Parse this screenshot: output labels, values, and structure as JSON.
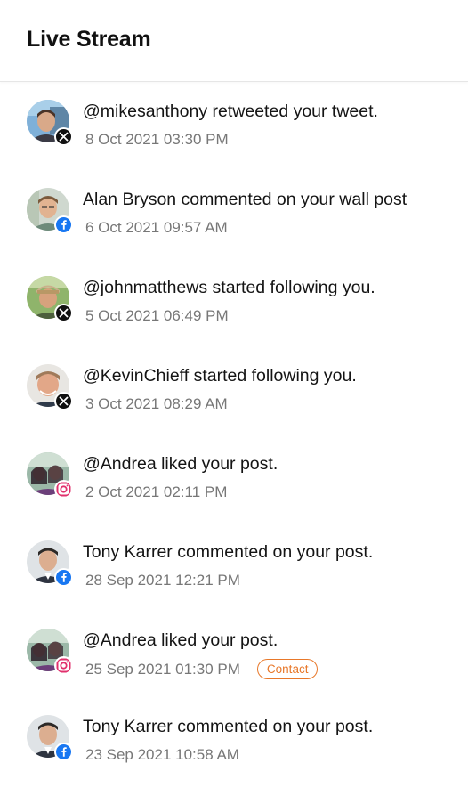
{
  "header": {
    "title": "Live Stream"
  },
  "stream": [
    {
      "message": "@mikesanthony retweeted your tweet.",
      "timestamp": "8 Oct 2021 03:30 PM",
      "network": "x-icon",
      "avatar": "a1"
    },
    {
      "message": "Alan Bryson commented on your wall post",
      "timestamp": "6 Oct 2021 09:57 AM",
      "network": "facebook-icon",
      "avatar": "a2"
    },
    {
      "message": "@johnmatthews started following you.",
      "timestamp": "5 Oct 2021 06:49 PM",
      "network": "x-icon",
      "avatar": "a3"
    },
    {
      "message": "@KevinChieff started following you.",
      "timestamp": "3 Oct 2021 08:29 AM",
      "network": "x-icon",
      "avatar": "a4"
    },
    {
      "message": "@Andrea liked your post.",
      "timestamp": "2 Oct 2021 02:11 PM",
      "network": "instagram-icon",
      "avatar": "a5"
    },
    {
      "message": "Tony Karrer commented on your post.",
      "timestamp": "28 Sep 2021 12:21 PM",
      "network": "facebook-icon",
      "avatar": "a6"
    },
    {
      "message": "@Andrea liked your post.",
      "timestamp": "25 Sep 2021 01:30 PM",
      "network": "instagram-icon",
      "avatar": "a5",
      "action": "Contact"
    },
    {
      "message": "Tony Karrer commented on your post.",
      "timestamp": "23 Sep 2021 10:58 AM",
      "network": "facebook-icon",
      "avatar": "a6"
    }
  ],
  "colors": {
    "accent_contact": "#e8782a",
    "facebook": "#1877f2",
    "x": "#111111",
    "timestamp": "#777777"
  }
}
